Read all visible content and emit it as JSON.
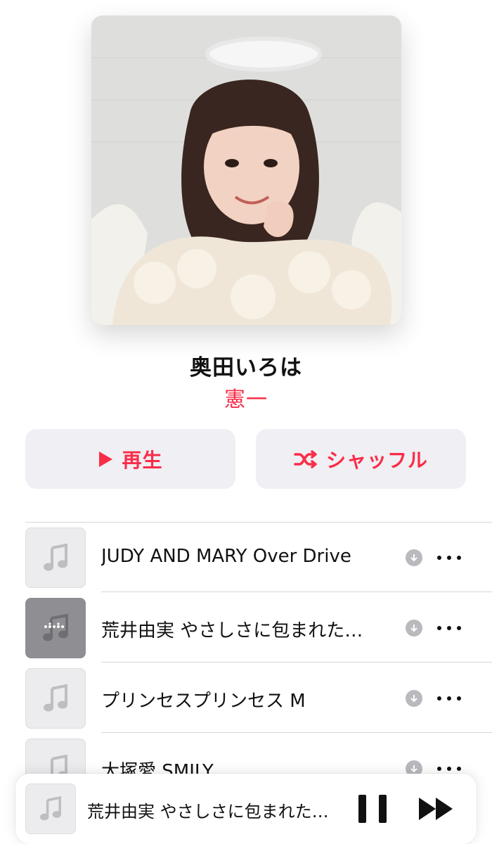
{
  "playlist": {
    "title": "奥田いろは",
    "curator": "憲一"
  },
  "actions": {
    "play_label": "再生",
    "shuffle_label": "シャッフル"
  },
  "tracks": [
    {
      "title": "JUDY AND MARY Over Drive",
      "now_playing": false
    },
    {
      "title": "荒井由実 やさしさに包まれた…",
      "now_playing": true
    },
    {
      "title": "プリンセスプリンセス M",
      "now_playing": false
    },
    {
      "title": "大塚愛 SMILY",
      "now_playing": false
    }
  ],
  "mini_player": {
    "title": "荒井由実 やさしさに包まれた…"
  },
  "colors": {
    "accent": "#fa2d48",
    "button_bg": "#efeff4",
    "separator": "#d6d6d8"
  },
  "icons": {
    "play": "play-icon",
    "shuffle": "shuffle-icon",
    "music_note": "music-note-icon",
    "download": "download-icon",
    "more": "more-icon",
    "pause": "pause-icon",
    "next": "forward-icon"
  }
}
